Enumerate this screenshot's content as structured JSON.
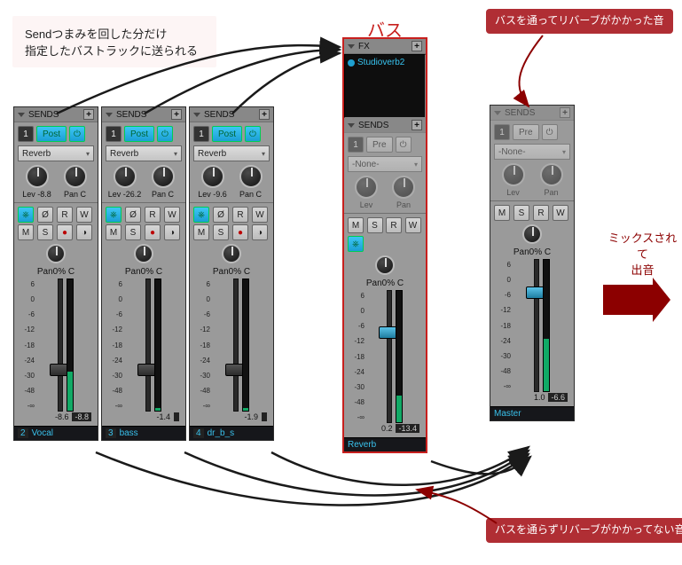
{
  "labels": {
    "sends": "SENDS",
    "fx": "FX",
    "post": "Post",
    "pre": "Pre",
    "lev": "Lev",
    "pan": "Pan",
    "panC": "C",
    "panText": "Pan0% C",
    "M": "M",
    "S": "S",
    "R": "R",
    "W": "W",
    "none": "-None-",
    "reverbSel": "Reverb"
  },
  "tracks": [
    {
      "num": "1",
      "sendNum": "2",
      "lev": "-8.8",
      "sel": "Reverb",
      "faderVal": "-8.6",
      "meterVal": "-8.8",
      "footer": "Vocal"
    },
    {
      "num": "1",
      "sendNum": "3",
      "lev": "-26.2",
      "sel": "Reverb",
      "faderVal": "-1.4",
      "meterVal": "",
      "footer": "bass"
    },
    {
      "num": "1",
      "sendNum": "4",
      "lev": "-9.6",
      "sel": "Reverb",
      "faderVal": "-1.9",
      "meterVal": "",
      "footer": "dr_b_s"
    }
  ],
  "bus": {
    "fxName": "Studioverb2",
    "faderVal": "0.2",
    "meterVal": "-13.4",
    "footer": "Reverb"
  },
  "master": {
    "faderVal": "1.0",
    "meterVal": "-6.6",
    "footer": "Master"
  },
  "scale": [
    "6",
    "0",
    "-6",
    "-12",
    "-18",
    "-24",
    "-30",
    "-48",
    "-∞"
  ],
  "annotations": {
    "note": "Sendつまみを回した分だけ\n指定したバストラックに送られる",
    "busTitle": "バス",
    "calloutTop": "バスを通ってリバーブがかかった音",
    "calloutBottom": "バスを通らずリバーブがかかってない音",
    "mixOut1": "ミックスされて",
    "mixOut2": "出音"
  }
}
